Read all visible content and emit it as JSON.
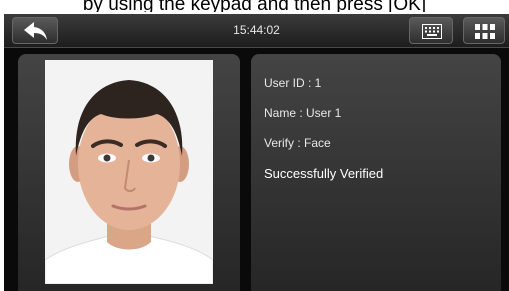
{
  "top_caption": "by using the keypad and then press [OK]",
  "topbar": {
    "time": "15:44:02",
    "back_icon": "back-arrow-icon",
    "keyboard_icon": "keyboard-icon",
    "menu_icon": "grid-menu-icon"
  },
  "photo": {
    "subject": "user-face-photo"
  },
  "info": {
    "user_id": "User ID : 1",
    "name": "Name : User 1",
    "verify": "Verify : Face",
    "status": "Successfully Verified"
  },
  "colors": {
    "background": "#0a0a0a",
    "panel": "#363636",
    "text": "#e8e8e8",
    "status": "#ffffff"
  }
}
